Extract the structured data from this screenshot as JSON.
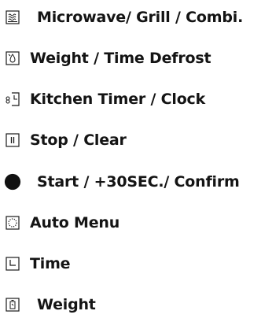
{
  "legend": {
    "items": [
      {
        "icon": "microwave-grill-combi-icon",
        "label": "Microwave/ Grill / Combi."
      },
      {
        "icon": "weight-time-defrost-icon",
        "label": "Weight / Time Defrost"
      },
      {
        "icon": "kitchen-timer-clock-icon",
        "label": "Kitchen Timer / Clock"
      },
      {
        "icon": "stop-clear-icon",
        "label": "Stop / Clear"
      },
      {
        "icon": "start-confirm-icon",
        "label": "Start / +30SEC./ Confirm"
      },
      {
        "icon": "auto-menu-icon",
        "label": "Auto Menu"
      },
      {
        "icon": "time-icon",
        "label": "Time"
      },
      {
        "icon": "weight-icon",
        "label": "Weight"
      }
    ]
  },
  "colors": {
    "text": "#141414",
    "icon_stroke": "#1a1a1a",
    "start_button_fill": "#111111"
  }
}
